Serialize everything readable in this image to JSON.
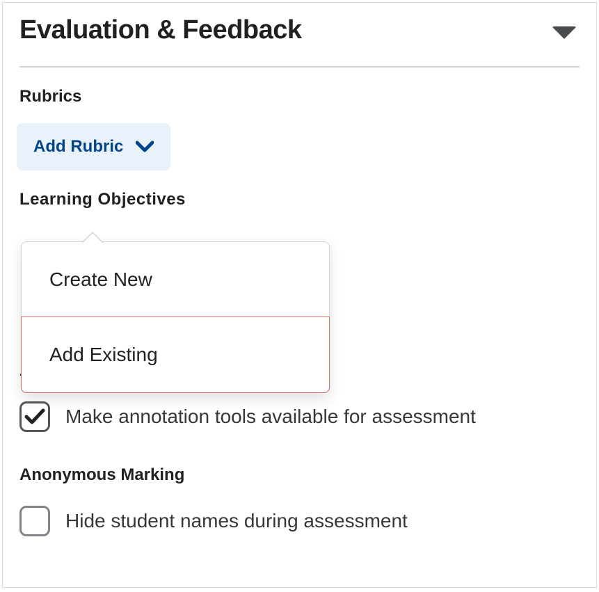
{
  "panel": {
    "title": "Evaluation & Feedback"
  },
  "rubrics": {
    "label": "Rubrics",
    "addButton": "Add Rubric",
    "menu": {
      "createNew": "Create New",
      "addExisting": "Add Existing"
    }
  },
  "obscured": {
    "learningObjectives": "Learning Objectives",
    "annotationTools": "Annotation Tools"
  },
  "annotation": {
    "checkboxLabel": "Make annotation tools available for assessment",
    "checked": true
  },
  "anonymous": {
    "label": "Anonymous Marking",
    "checkboxLabel": "Hide student names during assessment",
    "checked": false
  }
}
